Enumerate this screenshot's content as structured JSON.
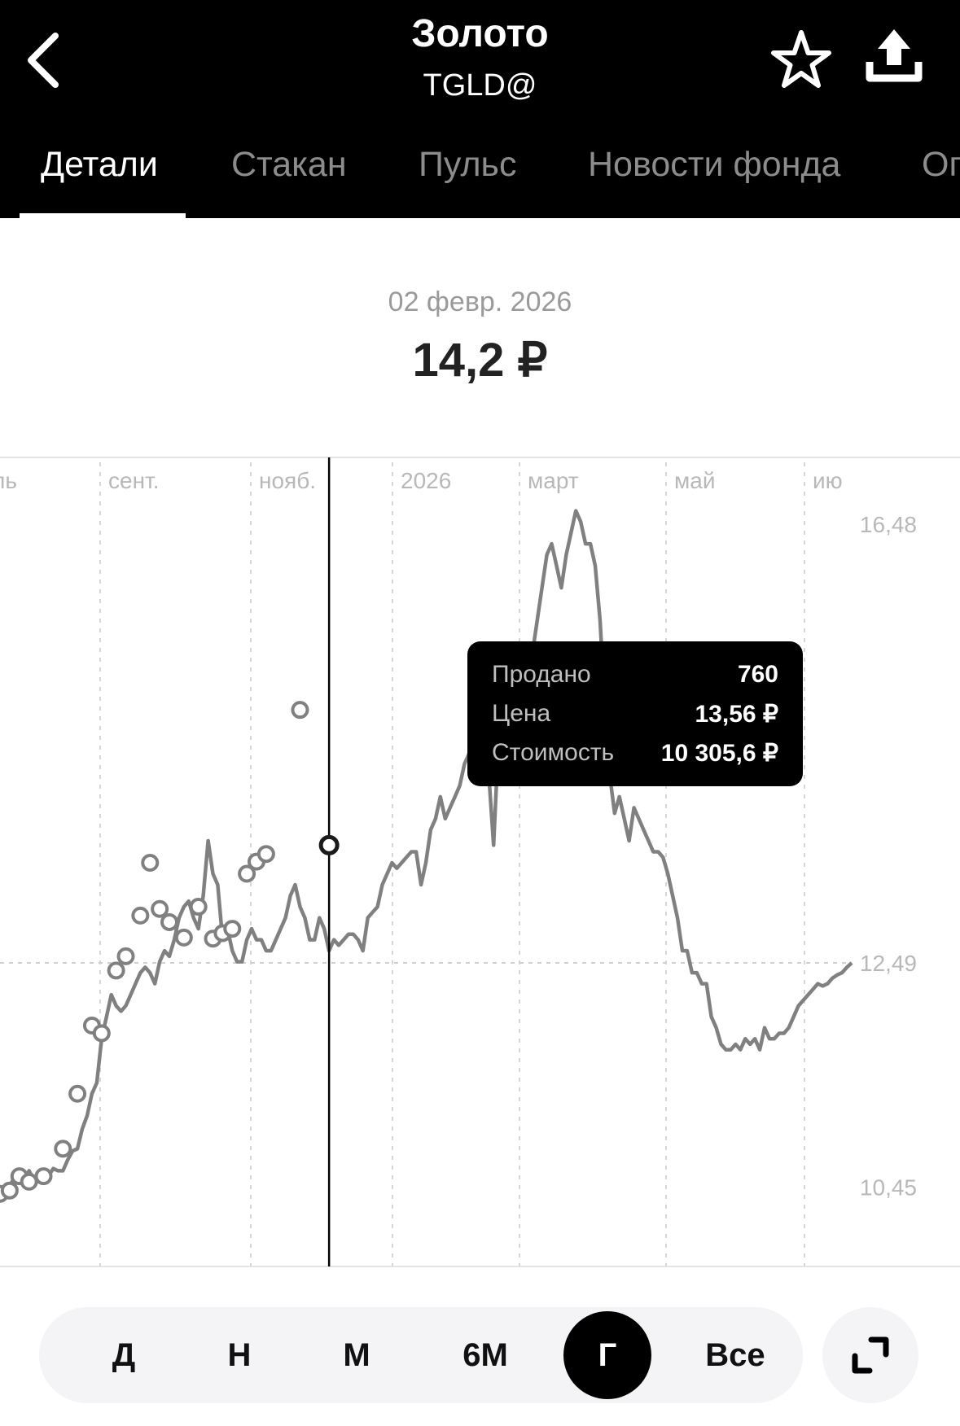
{
  "header": {
    "title": "Золото",
    "ticker": "TGLD@",
    "tabs": [
      {
        "label": "Детали",
        "active": true
      },
      {
        "label": "Стакан",
        "active": false
      },
      {
        "label": "Пульс",
        "active": false
      },
      {
        "label": "Новости фонда",
        "active": false
      },
      {
        "label": "Оп",
        "active": false
      }
    ],
    "icons": [
      "back-arrow-icon",
      "star-icon",
      "share-icon"
    ]
  },
  "quote": {
    "date": "02 февр. 2026",
    "price": "14,2 ₽"
  },
  "chart_data": {
    "type": "line",
    "x_tick_labels": [
      "ль",
      "сент.",
      "нояб.",
      "2026",
      "март",
      "май",
      "ию"
    ],
    "y_tick_labels": [
      "16,48",
      "12,49",
      "10,45"
    ],
    "ylim": [
      9.7,
      17.1
    ],
    "grid": true,
    "series": [
      {
        "values": [
          10.39,
          10.42,
          10.45,
          10.55,
          10.5,
          10.5,
          10.6,
          10.52,
          10.5,
          10.55,
          10.55,
          10.62,
          10.6,
          10.6,
          10.7,
          10.78,
          10.8,
          10.98,
          11.1,
          11.3,
          11.4,
          11.8,
          12.0,
          12.2,
          12.1,
          12.05,
          12.1,
          12.2,
          12.3,
          12.4,
          12.45,
          12.4,
          12.3,
          12.5,
          12.6,
          12.55,
          12.7,
          12.9,
          13.0,
          13.05,
          12.9,
          12.8,
          13.1,
          13.6,
          13.3,
          13.2,
          12.7,
          12.8,
          12.6,
          12.5,
          12.5,
          12.7,
          12.8,
          12.7,
          12.7,
          12.6,
          12.6,
          12.7,
          12.8,
          12.9,
          13.1,
          13.2,
          13.0,
          12.9,
          12.7,
          12.7,
          12.9,
          12.8,
          12.6,
          12.7,
          12.65,
          12.7,
          12.75,
          12.75,
          12.7,
          12.6,
          12.9,
          12.95,
          13.0,
          13.2,
          13.3,
          13.4,
          13.35,
          13.4,
          13.45,
          13.5,
          13.5,
          13.2,
          13.4,
          13.7,
          13.8,
          14.0,
          13.8,
          13.9,
          14.0,
          14.1,
          14.3,
          14.4,
          14.2,
          15.2,
          15.1,
          14.2,
          13.56,
          14.5,
          14.7,
          15.0,
          14.95,
          14.9,
          15.1,
          15.0,
          15.3,
          15.6,
          15.9,
          16.2,
          16.3,
          16.1,
          15.9,
          16.2,
          16.4,
          16.6,
          16.5,
          16.3,
          16.3,
          16.1,
          15.6,
          14.8,
          14.2,
          13.85,
          14.0,
          13.8,
          13.6,
          13.9,
          13.8,
          13.7,
          13.6,
          13.5,
          13.5,
          13.45,
          13.3,
          13.1,
          12.9,
          12.6,
          12.6,
          12.4,
          12.4,
          12.3,
          12.3,
          12.0,
          11.9,
          11.75,
          11.7,
          11.7,
          11.75,
          11.7,
          11.8,
          11.75,
          11.8,
          11.7,
          11.9,
          11.8,
          11.8,
          11.85,
          11.85,
          11.9,
          12.0,
          12.1,
          12.15,
          12.2,
          12.25,
          12.3,
          12.28,
          12.3,
          12.35,
          12.38,
          12.4,
          12.45,
          12.49
        ],
        "points": [
          {
            "x": 0,
            "y": 10.39
          },
          {
            "x": 2,
            "y": 10.42
          },
          {
            "x": 4,
            "y": 10.55
          },
          {
            "x": 6,
            "y": 10.5
          },
          {
            "x": 9,
            "y": 10.55
          },
          {
            "x": 13,
            "y": 10.8
          },
          {
            "x": 16,
            "y": 11.3
          },
          {
            "x": 19,
            "y": 11.92
          },
          {
            "x": 21,
            "y": 11.85
          },
          {
            "x": 24,
            "y": 12.42
          },
          {
            "x": 26,
            "y": 12.55
          },
          {
            "x": 29,
            "y": 12.92
          },
          {
            "x": 31,
            "y": 13.4
          },
          {
            "x": 33,
            "y": 12.98
          },
          {
            "x": 35,
            "y": 12.86
          },
          {
            "x": 38,
            "y": 12.72
          },
          {
            "x": 41,
            "y": 13.0
          },
          {
            "x": 44,
            "y": 12.71
          },
          {
            "x": 46,
            "y": 12.76
          },
          {
            "x": 48,
            "y": 12.8
          },
          {
            "x": 51,
            "y": 13.3
          },
          {
            "x": 53,
            "y": 13.41
          },
          {
            "x": 55,
            "y": 13.48
          },
          {
            "x": 62,
            "y": 14.79
          }
        ],
        "selected": {
          "x": 68,
          "y": 13.56
        }
      }
    ]
  },
  "tooltip": {
    "rows": [
      {
        "label": "Продано",
        "value": "760"
      },
      {
        "label": "Цена",
        "value": "13,56 ₽"
      },
      {
        "label": "Стоимость",
        "value": "10 305,6 ₽"
      }
    ]
  },
  "periods": {
    "items": [
      "Д",
      "Н",
      "М",
      "6М",
      "Г",
      "Все"
    ],
    "active": "Г"
  },
  "colors": {
    "header_bg": "#000000",
    "line": "#808080",
    "grid": "#d0d0d0",
    "active_tab": "#ffffff",
    "inactive_tab": "#8c8c8c"
  }
}
